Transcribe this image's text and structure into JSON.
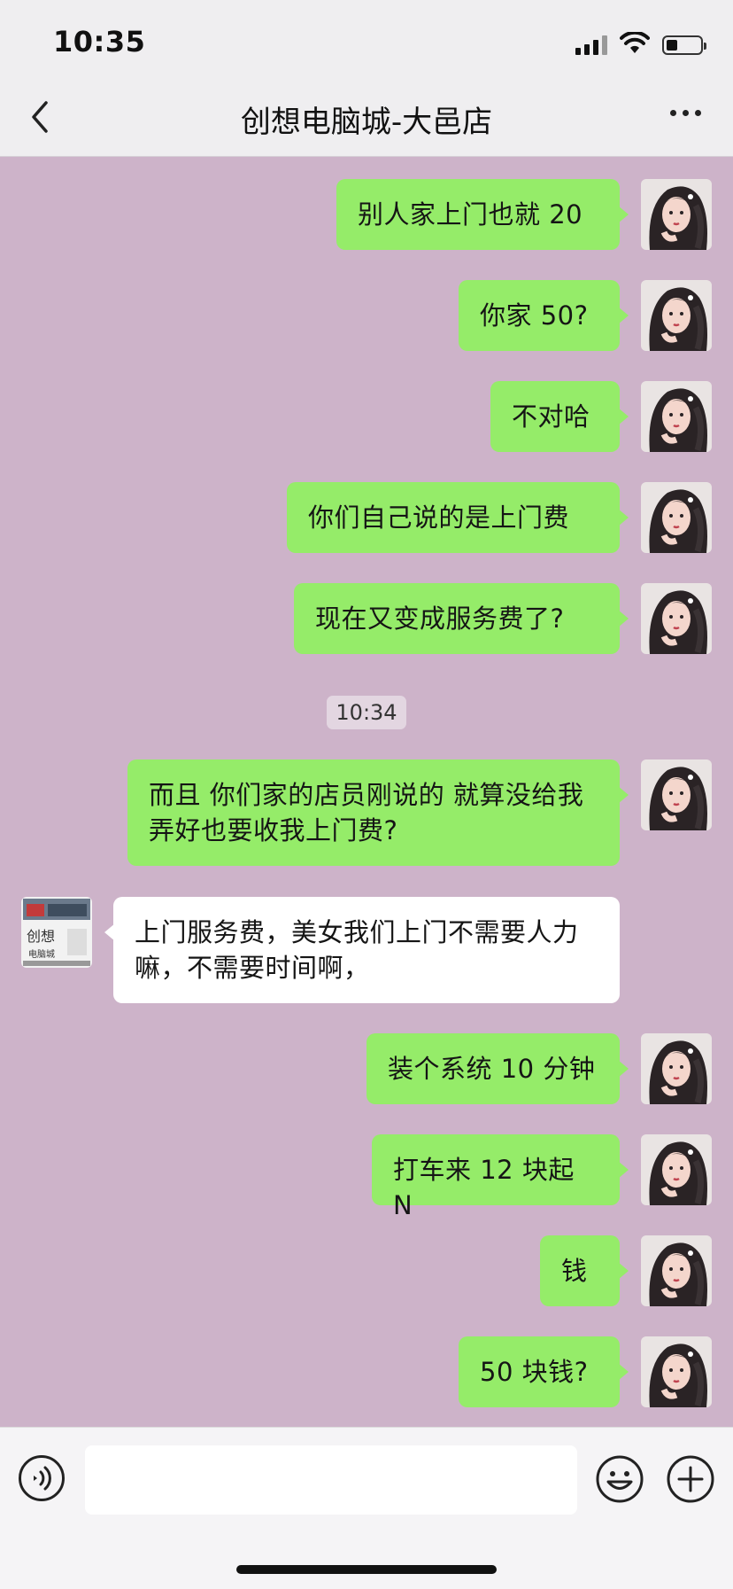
{
  "status_bar": {
    "time": "10:35"
  },
  "header": {
    "title": "创想电脑城-大邑店"
  },
  "messages": [
    {
      "side": "me",
      "text": "别人家上门也就 20"
    },
    {
      "side": "me",
      "text": "你家 50?"
    },
    {
      "side": "me",
      "text": "不对哈"
    },
    {
      "side": "me",
      "text": "你们自己说的是上门费"
    },
    {
      "side": "me",
      "text": "现在又变成服务费了?"
    },
    {
      "timestamp": "10:34"
    },
    {
      "side": "me",
      "text": "而且 你们家的店员刚说的 就算没给我弄好也要收我上门费?"
    },
    {
      "side": "them",
      "text": "上门服务费，美女我们上门不需要人力嘛，不需要时间啊，"
    },
    {
      "side": "me",
      "text": "装个系统 10 分钟"
    },
    {
      "side": "me",
      "text": "打车来 12 块起 N"
    },
    {
      "side": "me",
      "text": "钱"
    },
    {
      "side": "me",
      "text": "50 块钱?"
    }
  ],
  "shop_avatar": {
    "logo_text_top": "创想",
    "logo_text_bottom": "电脑城"
  },
  "input": {
    "value": ""
  },
  "colors": {
    "chat_bg": "#cdb3c9",
    "my_bubble": "#95ec69",
    "their_bubble": "#ffffff"
  }
}
